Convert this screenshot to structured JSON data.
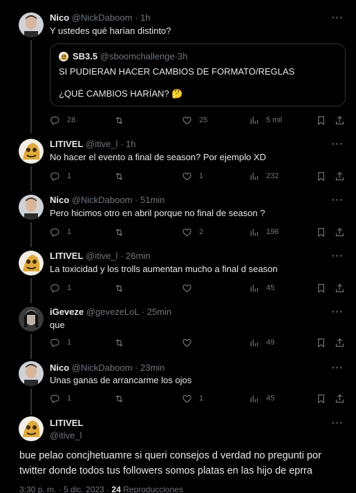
{
  "tweets": [
    {
      "name": "Nico",
      "handle": "@NickDaboom",
      "time": "1h",
      "text": "Y ustedes qué harían distinto?",
      "quote": {
        "name": "SB3.5",
        "handle": "@sboomchallenge",
        "time": "3h",
        "line1": "SI PUDIERAN HACER CAMBIOS DE FORMATO/REGLAS",
        "line2": "¿QUÉ CAMBIOS HARÍAN? 🤔"
      },
      "replies": "28",
      "retweets": "",
      "likes": "25",
      "views": "5 mil"
    },
    {
      "name": "LITIVEL",
      "handle": "@itive_l",
      "time": "1h",
      "text": "No hacer el evento a final de season? Por ejemplo XD",
      "replies": "1",
      "retweets": "",
      "likes": "1",
      "views": "232"
    },
    {
      "name": "Nico",
      "handle": "@NickDaboom",
      "time": "51min",
      "text": "Pero hicimos otro en abril porque no final de season ?",
      "replies": "1",
      "retweets": "",
      "likes": "2",
      "views": "196"
    },
    {
      "name": "LITIVEL",
      "handle": "@itive_l",
      "time": "26min",
      "text": "La toxicidad y los trolls aumentan mucho a final d season",
      "replies": "1",
      "retweets": "",
      "likes": "",
      "views": "45"
    },
    {
      "name": "iGeveze",
      "handle": "@gevezeLoL",
      "time": "25min",
      "text": "que",
      "replies": "1",
      "retweets": "",
      "likes": "",
      "views": "49"
    },
    {
      "name": "Nico",
      "handle": "@NickDaboom",
      "time": "23min",
      "text": "Unas ganas de arrancarme los ojos",
      "replies": "1",
      "retweets": "",
      "likes": "1",
      "views": "45"
    }
  ],
  "main_tweet": {
    "name": "LITIVEL",
    "handle": "@itive_l",
    "line1": "bue pelao concjhetuamre si queri consejos d verdad no pregunti por",
    "line2": "twitter donde todos tus followers somos platas en las hijo de eprra",
    "timestamp": "3:30 p. m. · 5 dic. 2023 · ",
    "views_count": "24",
    "views_label": " Reproducciones"
  },
  "separator": " · ",
  "more_glyph": "···",
  "colors": {
    "background": "#000000",
    "text": "#e7e9ea",
    "muted": "#71767b",
    "border": "#2f3336"
  },
  "icons": [
    "reply-icon",
    "retweet-icon",
    "like-icon",
    "views-icon",
    "bookmark-icon",
    "share-icon",
    "more-icon"
  ]
}
